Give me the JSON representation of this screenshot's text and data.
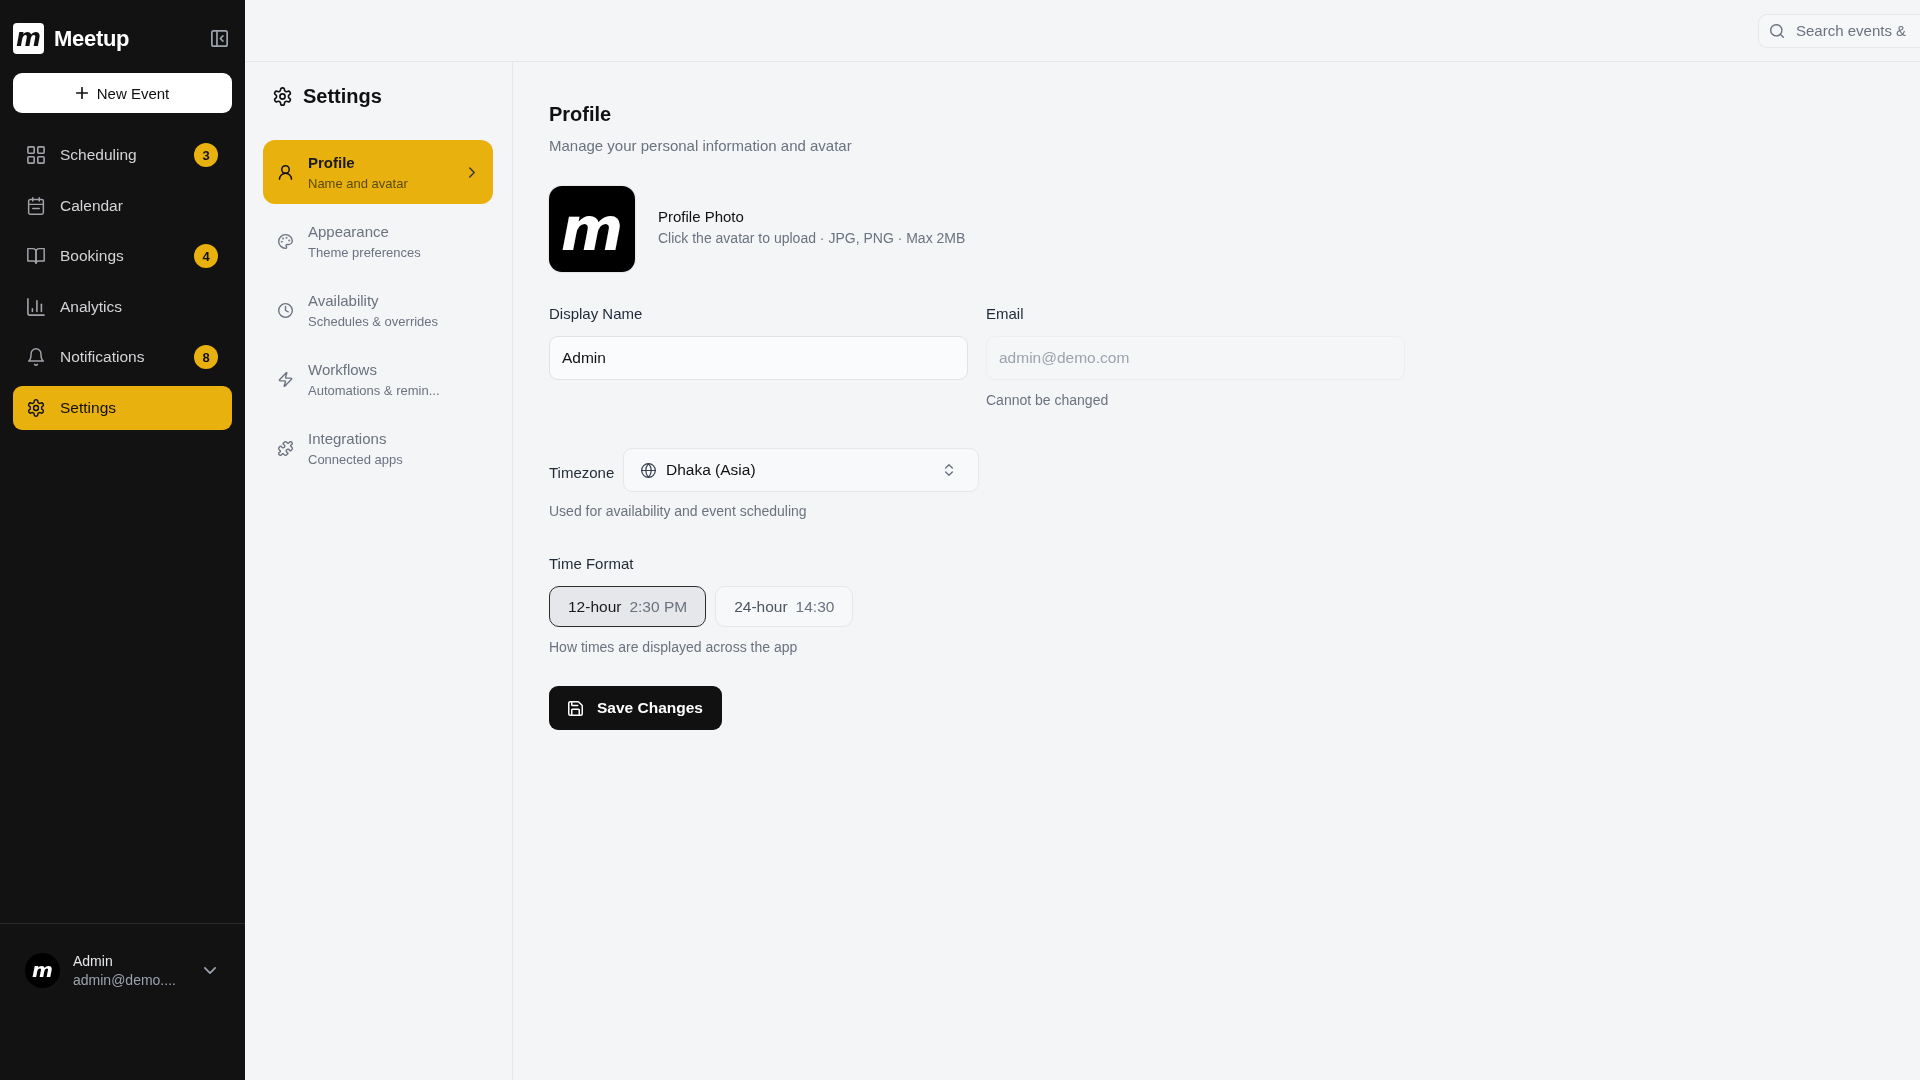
{
  "sidebar": {
    "logo": {
      "mark": "m",
      "name": "Meetup"
    },
    "new_event": {
      "label": "New Event"
    },
    "nav": [
      {
        "label": "Scheduling",
        "badge": "3",
        "selected": false
      },
      {
        "label": "Calendar",
        "selected": false
      },
      {
        "label": "Bookings",
        "badge": "4",
        "selected": false
      },
      {
        "label": "Analytics",
        "selected": false
      },
      {
        "label": "Notifications",
        "badge": "8",
        "selected": false
      },
      {
        "label": "Settings",
        "selected": true
      }
    ],
    "user": {
      "avatar_mark": "m",
      "name": "Admin",
      "email": "admin@demo...."
    }
  },
  "topbar": {
    "search": {
      "placeholder": "Search events &"
    }
  },
  "settings_nav": {
    "title": "Settings",
    "items": [
      {
        "title": "Profile",
        "subtitle": "Name and avatar",
        "selected": true
      },
      {
        "title": "Appearance",
        "subtitle": "Theme preferences",
        "selected": false
      },
      {
        "title": "Availability",
        "subtitle": "Schedules & overrides",
        "selected": false
      },
      {
        "title": "Workflows",
        "subtitle": "Automations & remin...",
        "selected": false
      },
      {
        "title": "Integrations",
        "subtitle": "Connected apps",
        "selected": false
      }
    ]
  },
  "profile": {
    "title": "Profile",
    "subtitle": "Manage your personal information and avatar",
    "photo": {
      "mark": "m",
      "title": "Profile Photo",
      "hint": "Click the avatar to upload · JPG, PNG · Max 2MB"
    },
    "display_name": {
      "label": "Display Name",
      "value": "Admin"
    },
    "email": {
      "label": "Email",
      "value": "admin@demo.com",
      "disabled": true,
      "hint": "Cannot be changed"
    },
    "timezone": {
      "label": "Timezone",
      "value": "Dhaka (Asia)",
      "hint": "Used for availability and event scheduling"
    },
    "time_format": {
      "label": "Time Format",
      "options": [
        {
          "label": "12-hour",
          "example": "2:30 PM",
          "selected": true
        },
        {
          "label": "24-hour",
          "example": "14:30",
          "selected": false
        }
      ],
      "hint": "How times are displayed across the app"
    },
    "save_button": {
      "label": "Save Changes"
    }
  }
}
